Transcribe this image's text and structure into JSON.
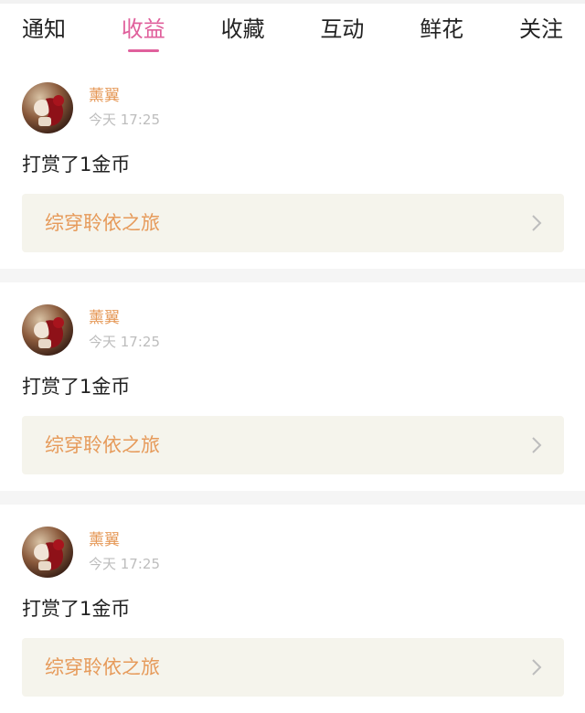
{
  "tabs": [
    {
      "label": "通知",
      "active": false
    },
    {
      "label": "收益",
      "active": true
    },
    {
      "label": "收藏",
      "active": false
    },
    {
      "label": "互动",
      "active": false
    },
    {
      "label": "鲜花",
      "active": false
    },
    {
      "label": "关注",
      "active": false
    }
  ],
  "colors": {
    "accent": "#e0609c",
    "username": "#e69a5a",
    "book_box_bg": "#f5f4ec",
    "separator": "#f5f5f5"
  },
  "items": [
    {
      "username": "薰翼",
      "time": "今天 17:25",
      "action": "打赏了1金币",
      "book_title": "综穿聆依之旅",
      "icon": "chevron-right-icon"
    },
    {
      "username": "薰翼",
      "time": "今天 17:25",
      "action": "打赏了1金币",
      "book_title": "综穿聆依之旅",
      "icon": "chevron-right-icon"
    },
    {
      "username": "薰翼",
      "time": "今天 17:25",
      "action": "打赏了1金币",
      "book_title": "综穿聆依之旅",
      "icon": "chevron-right-icon"
    }
  ]
}
